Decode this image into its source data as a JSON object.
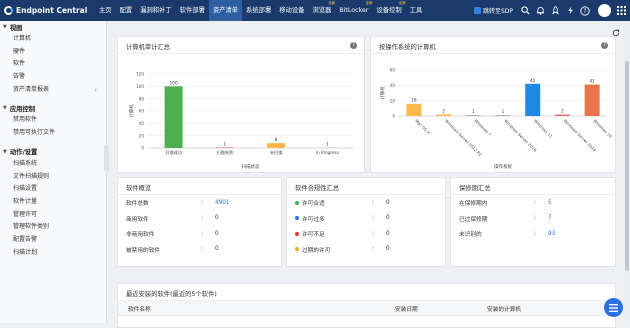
{
  "app": {
    "title": "Endpoint Central"
  },
  "nav": [
    {
      "label": "主页",
      "badge": ""
    },
    {
      "label": "配置",
      "badge": ""
    },
    {
      "label": "漏洞和补丁",
      "badge": ""
    },
    {
      "label": "软件部署",
      "badge": ""
    },
    {
      "label": "资产清单",
      "badge": ""
    },
    {
      "label": "系统部署",
      "badge": ""
    },
    {
      "label": "移动设备",
      "badge": ""
    },
    {
      "label": "浏览器",
      "badge": "全新"
    },
    {
      "label": "BitLocker",
      "badge": "全新"
    },
    {
      "label": "设备控制",
      "badge": "全新"
    },
    {
      "label": "工具",
      "badge": ""
    }
  ],
  "nav_active_index": 4,
  "topright": {
    "jump_label": "跳转至SDP",
    "icons": [
      "search-icon",
      "bell-icon",
      "rocket-icon",
      "bolt-icon",
      "help-icon"
    ]
  },
  "sidebar": {
    "sections": [
      {
        "title": "视图",
        "items": [
          "计算机",
          "硬件",
          "软件",
          "告警",
          "资产清单报表"
        ]
      },
      {
        "title": "应用控制",
        "items": [
          "禁用软件",
          "禁用可执行文件"
        ]
      },
      {
        "title": "动作/设置",
        "items": [
          "扫描系统",
          "文件扫描规则",
          "扫描设置",
          "软件计量",
          "管理许可",
          "管理软件类别",
          "配置告警",
          "扫描计划"
        ]
      }
    ]
  },
  "cards": {
    "scan_audit": {
      "title": "计算机审计汇总"
    },
    "by_os": {
      "title": "按操作系统的计算机"
    },
    "software_overview": {
      "title": "软件概览",
      "rows": [
        {
          "label": "软件总数",
          "value": "4901",
          "link": true
        },
        {
          "label": "商用软件",
          "value": "0",
          "link": false
        },
        {
          "label": "非商用软件",
          "value": "0",
          "link": false
        },
        {
          "label": "被禁用的软件",
          "value": "0",
          "link": false
        }
      ]
    },
    "compliance": {
      "title": "软件合规性汇总",
      "rows": [
        {
          "label": "许可合适",
          "value": "0",
          "color": "#4caf50"
        },
        {
          "label": "许可过多",
          "value": "0",
          "color": "#2a6fd6"
        },
        {
          "label": "许可不足",
          "value": "0",
          "color": "#e53935"
        },
        {
          "label": "过期的许可",
          "value": "0",
          "color": "#ffa726"
        }
      ]
    },
    "warranty": {
      "title": "保修期汇总",
      "rows": [
        {
          "label": "在保修期内",
          "value": "5"
        },
        {
          "label": "已过保修期",
          "value": "7"
        },
        {
          "label": "未识别的",
          "value": "93"
        }
      ]
    },
    "recent": {
      "title": "最近安装的软件(最近的5个软件)",
      "columns": [
        "软件名称",
        "安装日期",
        "安装的计算机"
      ]
    }
  },
  "chart_data": [
    {
      "type": "bar",
      "title": "计算机审计汇总",
      "xlabel": "扫描状态",
      "ylabel": "计算机",
      "categories": [
        "扫描成功",
        "扫描失败",
        "未扫描",
        "In Progress"
      ],
      "values": [
        100,
        1,
        8,
        1
      ],
      "colors": [
        "#4caf50",
        "#e57373",
        "#ffb74d",
        "#cccccc"
      ],
      "yticks": [
        0,
        20,
        40,
        60,
        80,
        100,
        120
      ],
      "ylim": [
        0,
        120
      ]
    },
    {
      "type": "bar",
      "title": "按操作系统的计算机",
      "xlabel": "操作系统",
      "ylabel": "计算机",
      "categories": [
        "Mac OS X",
        "Windows Server 2012 R2",
        "Windows 7",
        "Windows Server 2016",
        "Windows 11",
        "Windows Server 2019",
        "Windows 10"
      ],
      "values": [
        16,
        2,
        1,
        1,
        42,
        2,
        41
      ],
      "colors": [
        "#ffb74d",
        "#ffb74d",
        "#9e9e9e",
        "#9e9e9e",
        "#1e88e5",
        "#e57373",
        "#e8764a"
      ],
      "yticks": [
        0,
        20,
        40,
        60
      ],
      "ylim": [
        0,
        60
      ]
    }
  ]
}
